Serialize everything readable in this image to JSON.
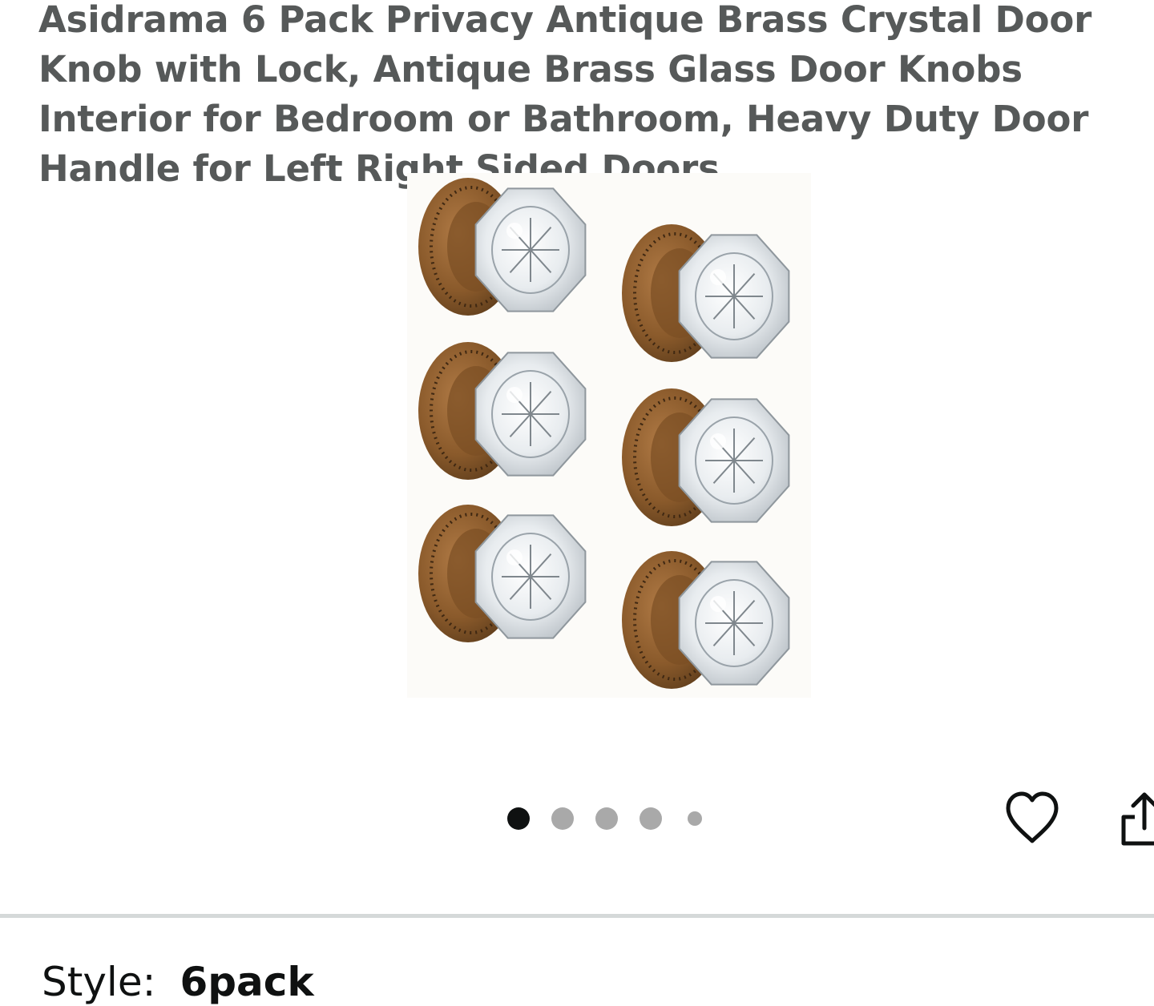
{
  "product": {
    "title": "Asidrama 6 Pack Privacy Antique Brass Crystal Door Knob with Lock, Antique Brass Glass Door Knobs Interior for Bedroom or Bathroom, Heavy Duty Door Handle for Left Right Sided Doors"
  },
  "gallery": {
    "image_count_dots": 5,
    "active_index": 0
  },
  "actions": {
    "wishlist_icon": "heart-icon",
    "share_icon": "share-icon"
  },
  "variation": {
    "label": "Style:",
    "value": "6pack"
  },
  "colors": {
    "text_primary": "#0f1111",
    "text_secondary": "#565959",
    "dot_active": "#0f1111",
    "dot_inactive": "#a9a9a9",
    "brass": "#8a5a2b",
    "divider": "#d5d9d9"
  }
}
